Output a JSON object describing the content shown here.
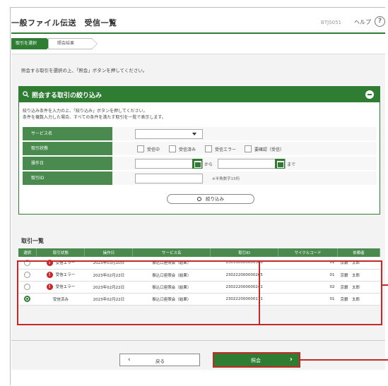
{
  "header": {
    "title": "一般ファイル伝送　受信一覧",
    "screen_id": "BTJS051",
    "help_label": "ヘルプ",
    "help_icon": "question-circle-icon"
  },
  "steps": [
    {
      "label": "取引を選択"
    },
    {
      "label": "照会結果"
    }
  ],
  "instruction": "照会する取引を選択の上、「照会」ボタンを押してください。",
  "filter": {
    "title": "照会する取引の絞り込み",
    "note_line1": "絞り込み条件を入力の上、「絞り込み」ボタンを押してください。",
    "note_line2": "条件を複数入力した場合、すべての条件を満たす取引を一覧で表示します。",
    "service_label": "サービス名",
    "status_label": "取引状態",
    "status_options": [
      "受信中",
      "受信済み",
      "受信エラー",
      "要確認（受信）"
    ],
    "date_label": "操作日",
    "date_from_sep": "から",
    "date_to_sep": "まで",
    "id_label": "取引ID",
    "id_hint": "※半角数字15桁",
    "button_label": "絞り込み"
  },
  "list": {
    "title": "取引一覧",
    "columns": [
      "選択",
      "取引状態",
      "操作日",
      "サービス名",
      "取引ID",
      "サイクルコード",
      "依頼者"
    ],
    "rows": [
      {
        "selected": false,
        "status": "受信エラー",
        "error": true,
        "date": "2023年03月10日",
        "service": "振込口座照会（結果）",
        "id": "230310000000368",
        "cycle": "01",
        "requester": "京銀　太郎"
      },
      {
        "selected": false,
        "status": "受信エラー",
        "error": true,
        "date": "2023年02月22日",
        "service": "振込口座照会（結果）",
        "id": "230222000000265",
        "cycle": "01",
        "requester": "京銀　太郎"
      },
      {
        "selected": false,
        "status": "受信エラー",
        "error": true,
        "date": "2023年02月22日",
        "service": "振込口座照会（結果）",
        "id": "230222000000241",
        "cycle": "02",
        "requester": "京銀　太郎"
      },
      {
        "selected": true,
        "status": "受信済み",
        "error": false,
        "date": "2023年02月22日",
        "service": "振込口座照会（結果）",
        "id": "230222000000111",
        "cycle": "01",
        "requester": "京銀　太郎"
      }
    ]
  },
  "footer": {
    "back_label": "戻る",
    "confirm_label": "照会"
  },
  "colors": {
    "brand_green": "#2e7d32",
    "label_green": "#4a8a4f",
    "highlight_red": "#c62828"
  }
}
